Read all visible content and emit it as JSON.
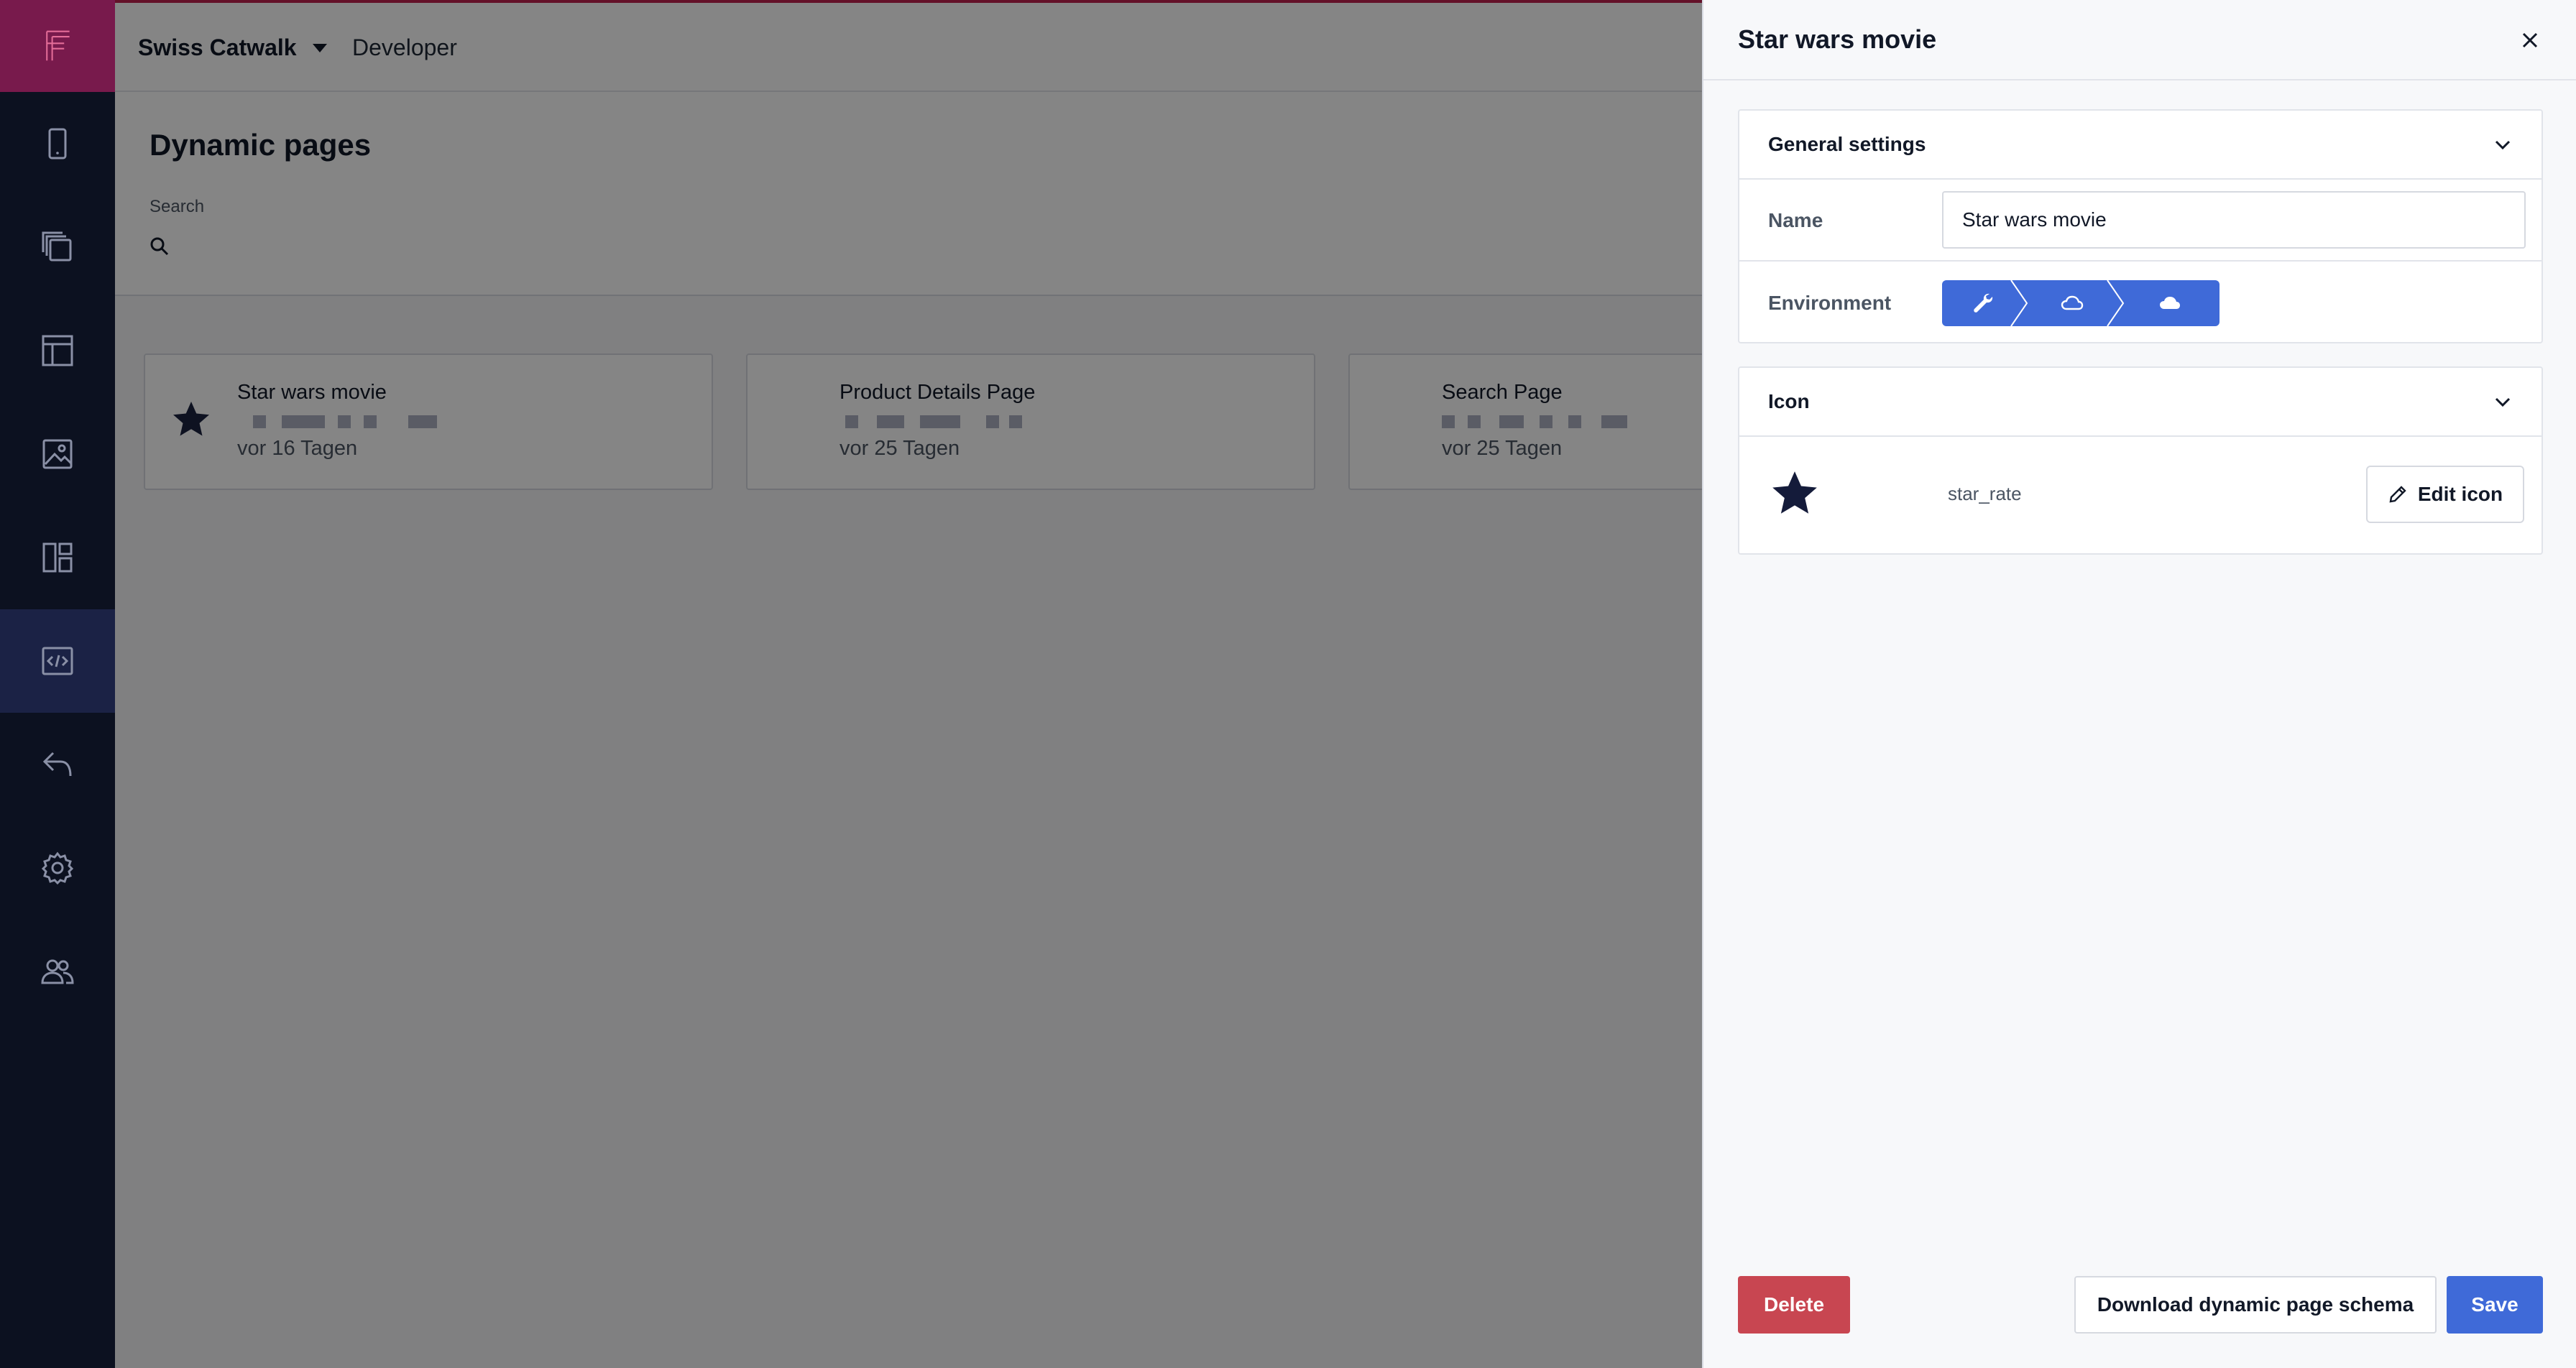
{
  "app": {
    "company": "Swiss Catwalk",
    "role": "Developer",
    "brand_color": "#781a4c",
    "accent_color": "#3f6ad8"
  },
  "sidebar": {
    "items": [
      {
        "icon": "mobile-icon"
      },
      {
        "icon": "pages-icon"
      },
      {
        "icon": "layout-icon"
      },
      {
        "icon": "image-icon"
      },
      {
        "icon": "dashboard-icon"
      },
      {
        "icon": "code-icon",
        "active": true
      },
      {
        "icon": "reply-icon"
      },
      {
        "icon": "gear-icon"
      },
      {
        "icon": "users-icon"
      }
    ]
  },
  "page": {
    "title": "Dynamic pages",
    "search_label": "Search",
    "search_placeholder": ""
  },
  "cards": [
    {
      "title": "Star wars movie",
      "date": "vor 16 Tagen",
      "icon": "star-icon"
    },
    {
      "title": "Product Details Page",
      "date": "vor 25 Tagen",
      "icon": ""
    },
    {
      "title": "Search Page",
      "date": "vor 25 Tagen",
      "icon": ""
    }
  ],
  "drawer": {
    "title": "Star wars movie",
    "general": {
      "heading": "General settings",
      "name_label": "Name",
      "name_value": "Star wars movie",
      "environment_label": "Environment",
      "environments": [
        "wrench-icon",
        "cloud-outline-icon",
        "cloud-filled-icon"
      ]
    },
    "icon_section": {
      "heading": "Icon",
      "icon_name": "star_rate",
      "edit_label": "Edit icon"
    },
    "footer": {
      "delete_label": "Delete",
      "download_label": "Download dynamic page schema",
      "save_label": "Save"
    }
  }
}
